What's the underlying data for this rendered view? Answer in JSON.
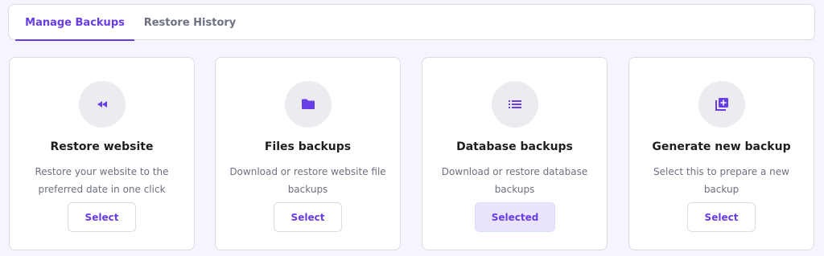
{
  "tabs": [
    {
      "label": "Manage Backups",
      "active": true
    },
    {
      "label": "Restore History",
      "active": false
    }
  ],
  "cards": [
    {
      "icon": "rewind-icon",
      "title": "Restore website",
      "description": "Restore your website to the preferred date in one click",
      "button": "Select",
      "selected": false
    },
    {
      "icon": "folder-icon",
      "title": "Files backups",
      "description": "Download or restore website file backups",
      "button": "Select",
      "selected": false
    },
    {
      "icon": "list-icon",
      "title": "Database backups",
      "description": "Download or restore database backups",
      "button": "Selected",
      "selected": true
    },
    {
      "icon": "add-stack-icon",
      "title": "Generate new backup",
      "description": "Select this to prepare a new backup",
      "button": "Select",
      "selected": false
    }
  ],
  "colors": {
    "accent": "#673de6",
    "background": "#f4f5ff",
    "selected_bg": "#ebe4ff",
    "icon_circle": "#ebebf0"
  }
}
